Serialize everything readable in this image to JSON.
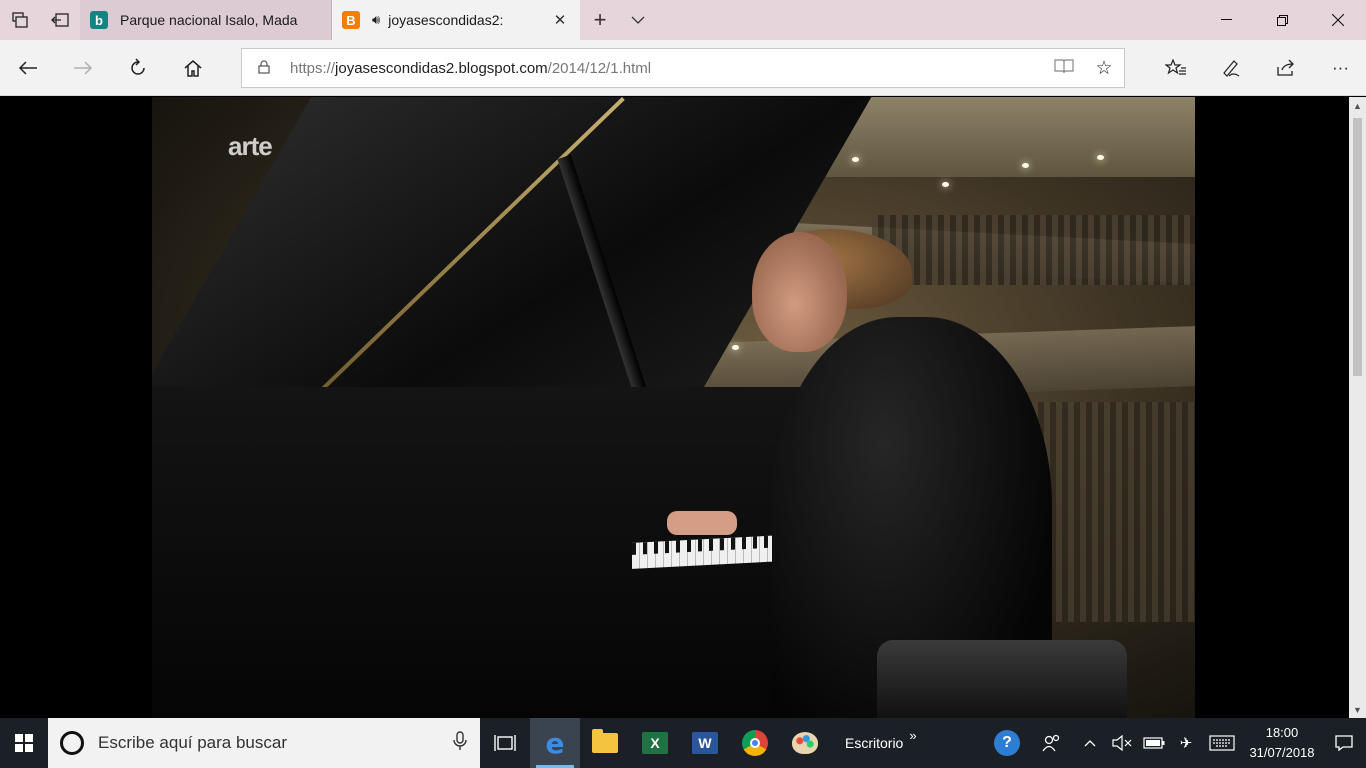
{
  "browser": {
    "tabs": [
      {
        "title": "Parque nacional Isalo, Mada",
        "favicon": "bing-icon",
        "active": false
      },
      {
        "title": "joyasescondidas2: ",
        "favicon": "blogger-icon",
        "active": true,
        "audio": true
      }
    ],
    "address": {
      "scheme": "https://",
      "host": "joyasescondidas2.blogspot.com",
      "path": "/2014/12/1.html"
    }
  },
  "video": {
    "watermark": "arte"
  },
  "taskbar": {
    "search_placeholder": "Escribe aquí para buscar",
    "desktop_label": "Escritorio",
    "clock_time": "18:00",
    "clock_date": "31/07/2018",
    "apps": [
      "task-view",
      "edge",
      "file-explorer",
      "excel",
      "word",
      "chrome",
      "paint"
    ]
  },
  "colors": {
    "tabbar": "#e6d6dc",
    "taskbar": "#1a2026",
    "accent": "#76b9ed"
  }
}
